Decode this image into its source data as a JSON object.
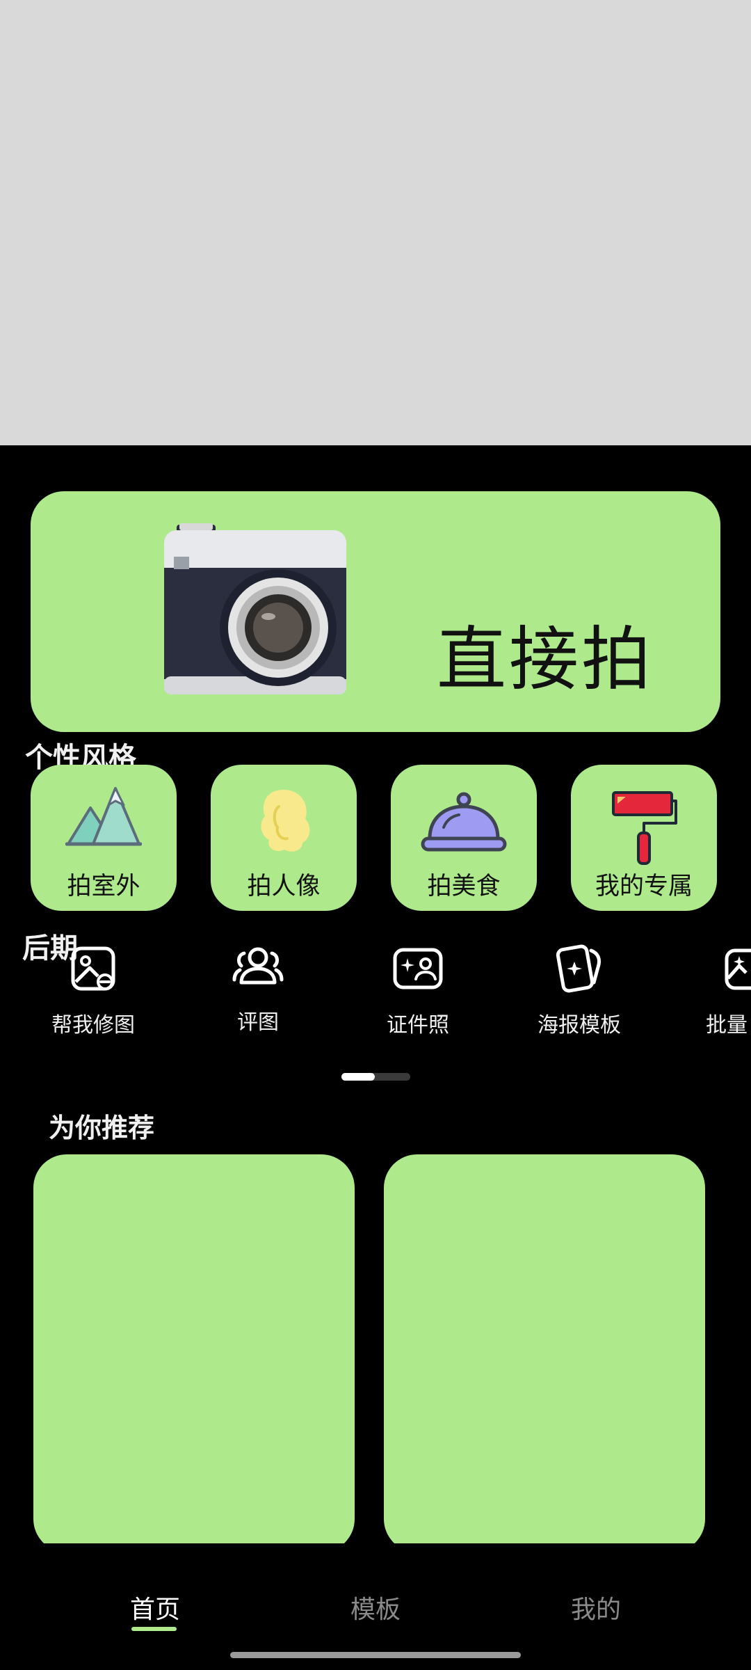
{
  "hero": {
    "title": "直接拍"
  },
  "style_section": {
    "title": "个性风格",
    "items": [
      {
        "label": "拍室外",
        "icon": "mountain-icon"
      },
      {
        "label": "拍人像",
        "icon": "portrait-icon"
      },
      {
        "label": "拍美食",
        "icon": "food-cloche-icon"
      },
      {
        "label": "我的专属",
        "icon": "paint-roller-icon"
      }
    ]
  },
  "post_section": {
    "title": "后期",
    "tools": [
      {
        "label": "帮我修图",
        "icon": "photo-edit-icon"
      },
      {
        "label": "评图",
        "icon": "users-icon"
      },
      {
        "label": "证件照",
        "icon": "id-photo-icon"
      },
      {
        "label": "海报模板",
        "icon": "poster-icon"
      },
      {
        "label": "批量",
        "icon": "batch-edit-icon"
      }
    ]
  },
  "recommend": {
    "title": "为你推荐"
  },
  "nav": {
    "items": [
      {
        "label": "首页",
        "active": true
      },
      {
        "label": "模板",
        "active": false
      },
      {
        "label": "我的",
        "active": false
      }
    ]
  },
  "colors": {
    "accent": "#aeea8c",
    "background": "#000000",
    "top_placeholder": "#d9d9d9"
  }
}
